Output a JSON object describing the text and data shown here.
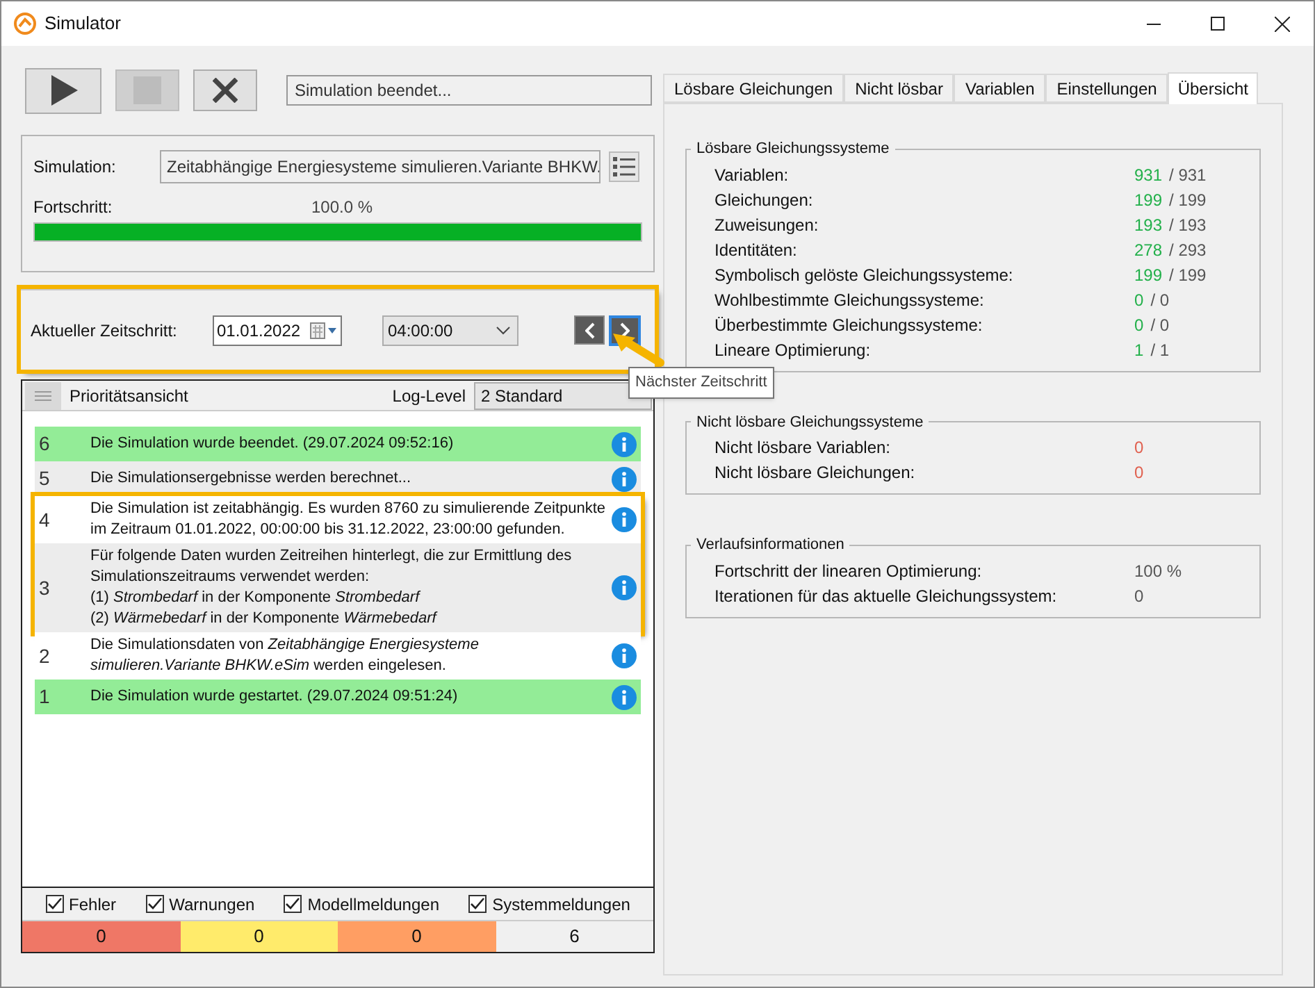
{
  "window": {
    "title": "Simulator"
  },
  "toolbar": {
    "status": "Simulation beendet..."
  },
  "simulation": {
    "label": "Simulation:",
    "value": "Zeitabhängige Energiesysteme simulieren.Variante BHKW.",
    "progress_label": "Fortschritt:",
    "reading": "100.0 %",
    "level": 1
  },
  "timestep": {
    "label": "Aktueller Zeitschritt:",
    "date": "01.01.2022",
    "time": "04:00:00",
    "tooltip": "Nächster Zeitschritt",
    "annotated": true
  },
  "log": {
    "title": "Prioritätsansicht",
    "level_label": "Log-Level",
    "level_value": "2 Standard",
    "entries": [
      {
        "number": "6",
        "text": "Die Simulation wurde beendet. (29.07.2024 09:52:16)",
        "highlighted": true,
        "annotated": false
      },
      {
        "number": "5",
        "text": "Die Simulationsergebnisse werden berechnet...",
        "highlighted": false,
        "annotated": false
      },
      {
        "number": "4",
        "text": "Die Simulation ist zeitabhängig. Es wurden 8760 zu simulierende Zeitpunkte im Zeitraum 01.01.2022, 00:00:00 bis 31.12.2022, 23:00:00 gefunden.",
        "highlighted": false,
        "annotated": true
      },
      {
        "number": "3",
        "text": "Für folgende Daten wurden Zeitreihen hinterlegt, die zur Ermittlung des Simulationszeitraums verwendet werden:\n(1) *Strombedarf* in der Komponente *Strombedarf*\n(2) *Wärmebedarf* in der Komponente *Wärmebedarf*",
        "highlighted": false,
        "annotated": true
      },
      {
        "number": "2",
        "text": "Die Simulationsdaten von *Zeitabhängige Energiesysteme simulieren.Variante BHKW.eSim* werden eingelesen.",
        "highlighted": false,
        "annotated": false
      },
      {
        "number": "1",
        "text": "Die Simulation wurde gestartet. (29.07.2024 09:51:24)",
        "highlighted": true,
        "annotated": false
      }
    ],
    "filters": [
      {
        "label": "Fehler",
        "checked": true
      },
      {
        "label": "Warnungen",
        "checked": true
      },
      {
        "label": "Modellmeldungen",
        "checked": true
      },
      {
        "label": "Systemmeldungen",
        "checked": true
      }
    ],
    "counts": [
      {
        "value": "0",
        "color": "#ef7766"
      },
      {
        "value": "0",
        "color": "#ffeb6b"
      },
      {
        "value": "0",
        "color": "#ff9e63"
      },
      {
        "value": "6",
        "color": "#f0f0f0"
      }
    ]
  },
  "tabs": [
    {
      "label": "Lösbare Gleichungen",
      "selected": false
    },
    {
      "label": "Nicht lösbar",
      "selected": false
    },
    {
      "label": "Variablen",
      "selected": false
    },
    {
      "label": "Einstellungen",
      "selected": false
    },
    {
      "label": "Übersicht",
      "selected": true
    }
  ],
  "groups": [
    {
      "title": "Lösbare Gleichungssysteme",
      "rows": [
        {
          "label": "Variablen:",
          "value": "931",
          "total": "/ 931",
          "kind": "ok"
        },
        {
          "label": "Gleichungen:",
          "value": "199",
          "total": "/ 199",
          "kind": "ok"
        },
        {
          "label": "Zuweisungen:",
          "value": "193",
          "total": "/ 193",
          "kind": "ok"
        },
        {
          "label": "Identitäten:",
          "value": "278",
          "total": "/ 293",
          "kind": "ok"
        },
        {
          "label": "Symbolisch gelöste Gleichungssysteme:",
          "value": "199",
          "total": "/ 199",
          "kind": "ok"
        },
        {
          "label": "Wohlbestimmte Gleichungssysteme:",
          "value": "0",
          "total": "/ 0",
          "kind": "ok"
        },
        {
          "label": "Überbestimmte Gleichungssysteme:",
          "value": "0",
          "total": "/ 0",
          "kind": "ok"
        },
        {
          "label": "Lineare Optimierung:",
          "value": "1",
          "total": "/ 1",
          "kind": "ok"
        }
      ]
    },
    {
      "title": "Nicht lösbare Gleichungssysteme",
      "rows": [
        {
          "label": "Nicht lösbare Variablen:",
          "value": "0",
          "kind": "error"
        },
        {
          "label": "Nicht lösbare Gleichungen:",
          "value": "0",
          "kind": "error"
        }
      ]
    },
    {
      "title": "Verlaufsinformationen",
      "rows": [
        {
          "label": "Fortschritt der linearen Optimierung:",
          "value": "100 %",
          "kind": "plain"
        },
        {
          "label": "Iterationen für das aktuelle Gleichungssystem:",
          "value": "0",
          "kind": "plain"
        }
      ]
    }
  ]
}
